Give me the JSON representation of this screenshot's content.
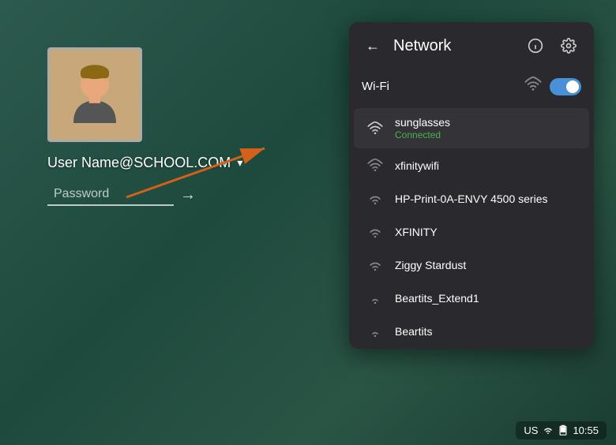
{
  "desktop": {
    "bg_color": "#2d5a4e"
  },
  "login": {
    "username": "User Name@SCHOOL.COM",
    "password_placeholder": "Password"
  },
  "network_panel": {
    "title": "Network",
    "back_label": "←",
    "info_icon": "ℹ",
    "gear_icon": "⚙",
    "wifi_label": "Wi-Fi",
    "wifi_enabled": true,
    "networks": [
      {
        "name": "sunglasses",
        "status": "Connected",
        "connected": true
      },
      {
        "name": "xfinitywifi",
        "status": "",
        "connected": false
      },
      {
        "name": "HP-Print-0A-ENVY 4500 series",
        "status": "",
        "connected": false
      },
      {
        "name": "XFINITY",
        "status": "",
        "connected": false
      },
      {
        "name": "Ziggy Stardust",
        "status": "",
        "connected": false
      },
      {
        "name": "Beartits_Extend1",
        "status": "",
        "connected": false
      },
      {
        "name": "Beartits",
        "status": "",
        "connected": false
      }
    ]
  },
  "taskbar": {
    "locale": "US",
    "time": "10:55"
  }
}
